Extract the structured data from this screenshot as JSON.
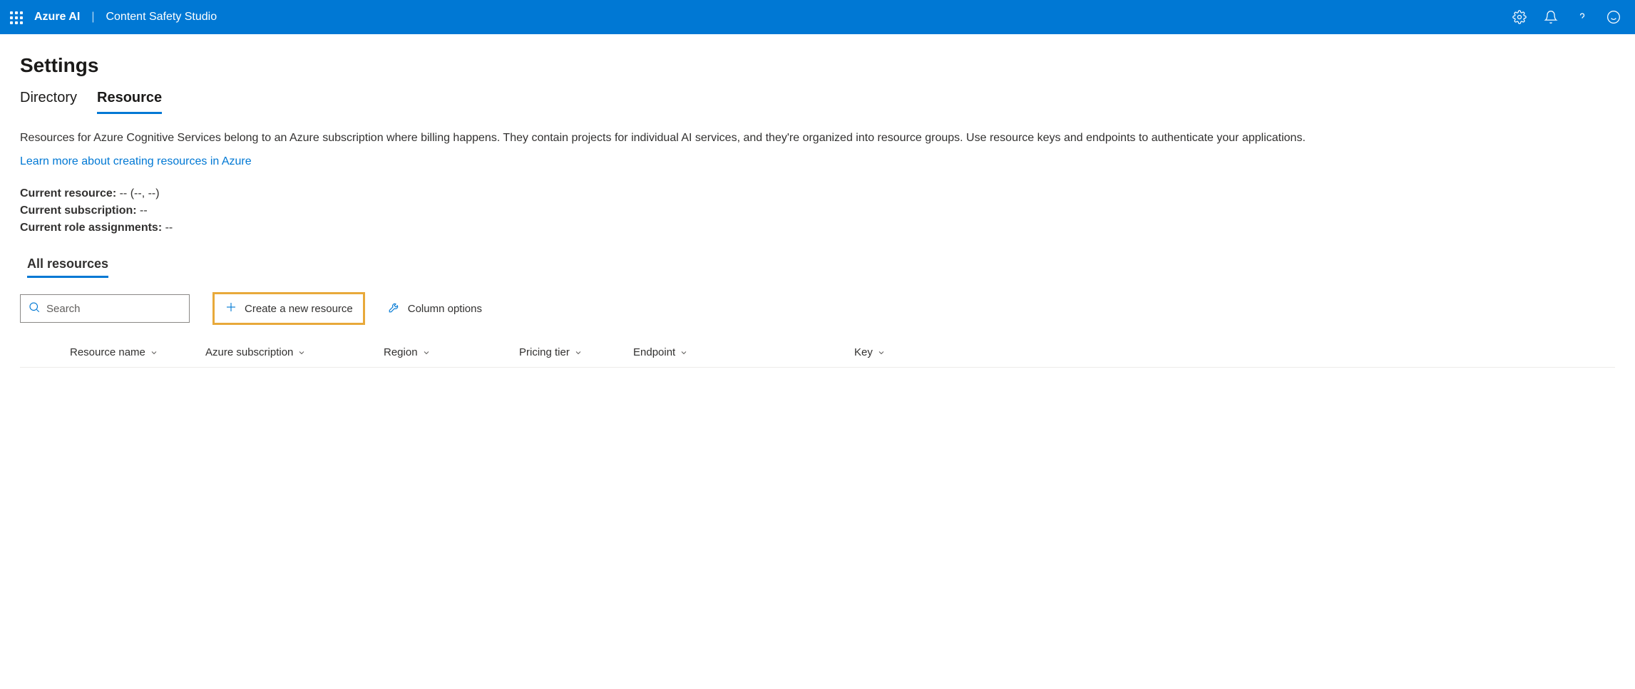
{
  "header": {
    "brand": "Azure AI",
    "subtitle": "Content Safety Studio"
  },
  "page": {
    "title": "Settings",
    "tabs": [
      {
        "label": "Directory",
        "active": false
      },
      {
        "label": "Resource",
        "active": true
      }
    ],
    "description": "Resources for Azure Cognitive Services belong to an Azure subscription where billing happens. They contain projects for individual AI services, and they're organized into resource groups. Use resource keys and endpoints to authenticate your applications.",
    "learn_more": "Learn more about creating resources in Azure",
    "current": {
      "resource_label": "Current resource:",
      "resource_value": " -- (--, --)",
      "subscription_label": "Current subscription:",
      "subscription_value": " --",
      "role_label": "Current role assignments:",
      "role_value": " --"
    },
    "section_tab": "All resources",
    "search_placeholder": "Search",
    "create_button": "Create a new resource",
    "column_options": "Column options",
    "table_headers": {
      "resource_name": "Resource name",
      "subscription": "Azure subscription",
      "region": "Region",
      "pricing": "Pricing tier",
      "endpoint": "Endpoint",
      "key": "Key"
    }
  }
}
